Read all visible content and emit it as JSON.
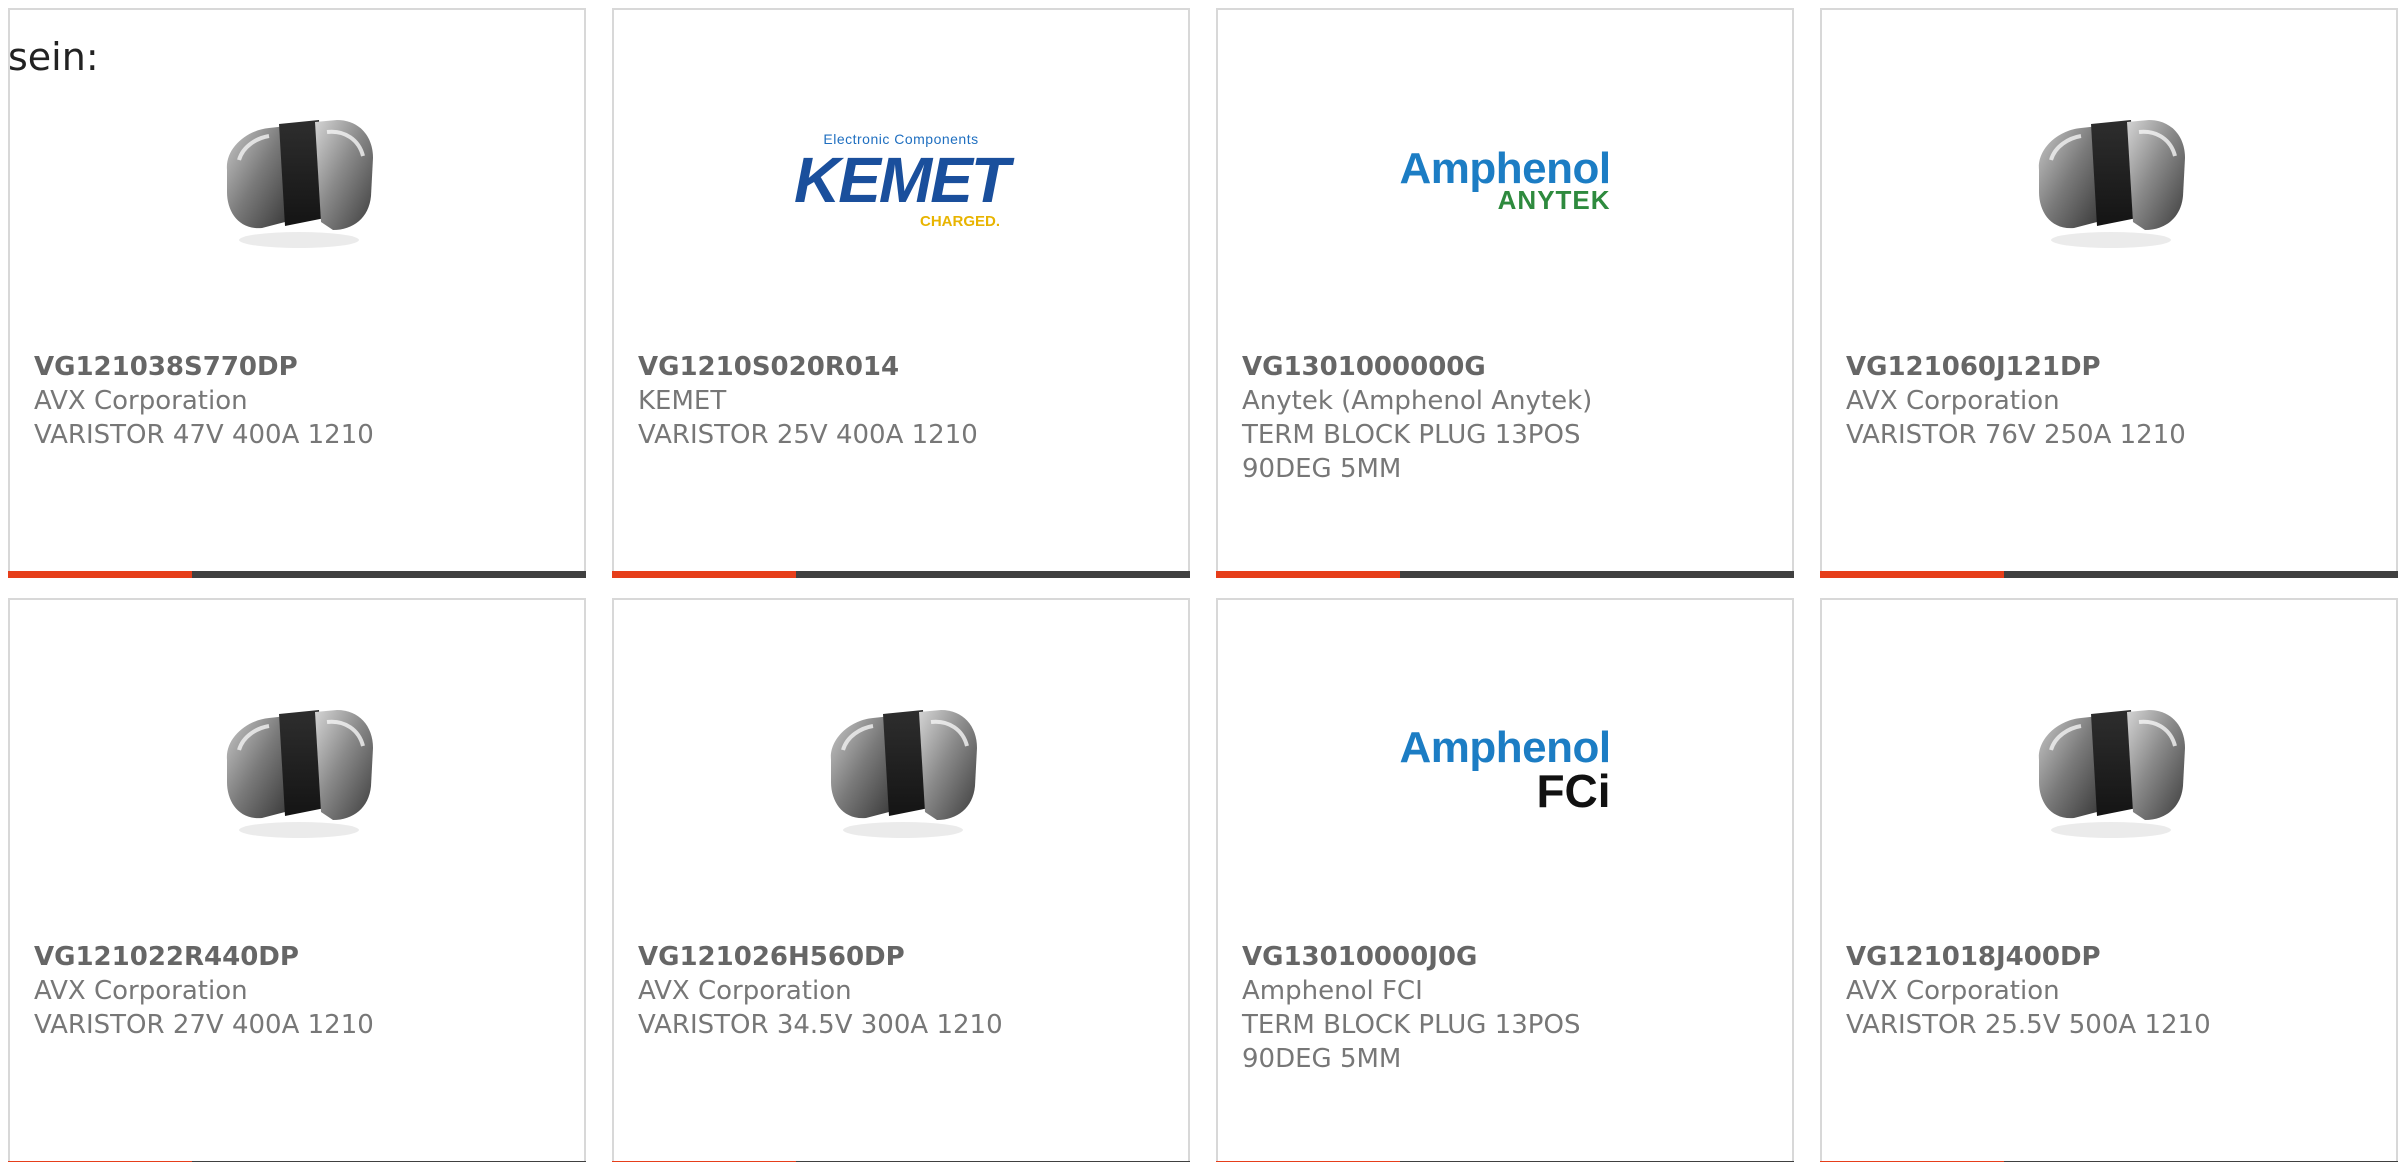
{
  "intro": {
    "text": "sein:"
  },
  "colors": {
    "accent_bar": "#e63e1a",
    "bar_base": "#404040",
    "card_border": "#d8d8d8",
    "text_gray": "#777777"
  },
  "products": [
    {
      "sku": "VG121038S770DP",
      "manufacturer": "AVX Corporation",
      "description": "VARISTOR 47V 400A 1210",
      "image": "varistor-chip-icon"
    },
    {
      "sku": "VG1210S020R014",
      "manufacturer": "KEMET",
      "description": "VARISTOR 25V 400A 1210",
      "image": "kemet-logo",
      "logo": {
        "top": "Electronic Components",
        "main": "KEMET",
        "sub": "CHARGED."
      }
    },
    {
      "sku": "VG1301000000G",
      "manufacturer": "Anytek (Amphenol Anytek)",
      "description": "TERM BLOCK PLUG 13POS 90DEG 5MM",
      "image": "amphenol-anytek-logo",
      "logo": {
        "main": "Amphenol",
        "sub": "ANYTEK"
      }
    },
    {
      "sku": "VG121060J121DP",
      "manufacturer": "AVX Corporation",
      "description": "VARISTOR 76V 250A 1210",
      "image": "varistor-chip-icon"
    },
    {
      "sku": "VG121022R440DP",
      "manufacturer": "AVX Corporation",
      "description": "VARISTOR 27V 400A 1210",
      "image": "varistor-chip-icon"
    },
    {
      "sku": "VG121026H560DP",
      "manufacturer": "AVX Corporation",
      "description": "VARISTOR 34.5V 300A 1210",
      "image": "varistor-chip-icon"
    },
    {
      "sku": "VG13010000J0G",
      "manufacturer": "Amphenol FCI",
      "description": "TERM BLOCK PLUG 13POS 90DEG 5MM",
      "image": "amphenol-fci-logo",
      "logo": {
        "main": "Amphenol",
        "sub": "FCi"
      }
    },
    {
      "sku": "VG121018J400DP",
      "manufacturer": "AVX Corporation",
      "description": "VARISTOR 25.5V 500A 1210",
      "image": "varistor-chip-icon"
    }
  ]
}
